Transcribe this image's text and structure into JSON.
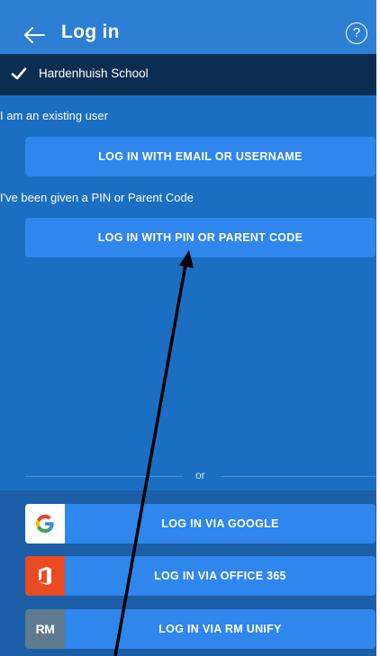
{
  "header": {
    "title": "Log in",
    "back_icon": "arrow-left-icon",
    "help_icon": "question-circle-icon",
    "help_glyph": "?"
  },
  "school": {
    "name": "Hardenhuish School",
    "icon": "check-icon"
  },
  "existing_user": {
    "label": "I am an existing user",
    "button": "LOG IN WITH EMAIL OR USERNAME"
  },
  "pin": {
    "label": "I've been given a PIN or Parent Code",
    "button": "LOG IN WITH PIN OR PARENT CODE"
  },
  "divider": {
    "text": "or"
  },
  "sso": [
    {
      "provider": "google",
      "label": "LOG IN VIA GOOGLE",
      "icon": "google-icon"
    },
    {
      "provider": "office365",
      "label": "LOG IN VIA OFFICE 365",
      "icon": "office-365-icon"
    },
    {
      "provider": "rm-unify",
      "label": "LOG IN VIA RM UNIFY",
      "icon": "rm-unify-icon",
      "logo_text": "RM"
    }
  ],
  "colors": {
    "appbar": "#2d7fd4",
    "background": "#1a6fc2",
    "school_bar": "#0c2d52",
    "button": "#2f86ec",
    "office_orange": "#eb4b22",
    "rm_gray": "#5f7a8e"
  }
}
